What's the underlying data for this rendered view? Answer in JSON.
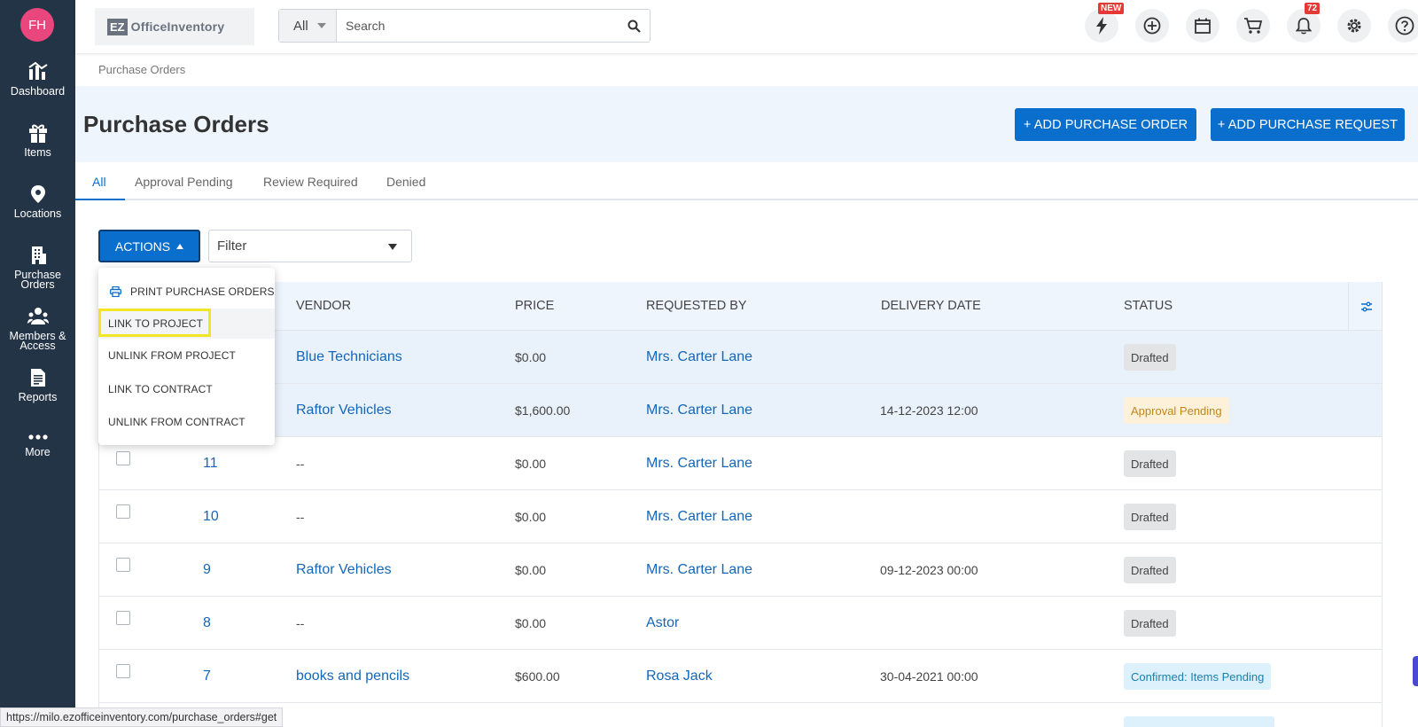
{
  "user": {
    "initials": "FH"
  },
  "sidebar": {
    "items": [
      {
        "id": "dashboard",
        "line1": "Dashboard",
        "line2": ""
      },
      {
        "id": "items",
        "line1": "Items",
        "line2": ""
      },
      {
        "id": "locations",
        "line1": "Locations",
        "line2": ""
      },
      {
        "id": "purchase-orders",
        "line1": "Purchase",
        "line2": "Orders"
      },
      {
        "id": "members",
        "line1": "Members &",
        "line2": "Access"
      },
      {
        "id": "reports",
        "line1": "Reports",
        "line2": ""
      },
      {
        "id": "more",
        "line1": "More",
        "line2": ""
      }
    ]
  },
  "logo": {
    "mark": "EZ",
    "text": "OfficeInventory"
  },
  "search": {
    "scope": "All",
    "placeholder": "Search"
  },
  "top_icons": {
    "new_badge": "NEW",
    "notification_count": "72"
  },
  "breadcrumb": "Purchase Orders",
  "page": {
    "title": "Purchase Orders",
    "add_order_label": "+ ADD PURCHASE ORDER",
    "add_request_label": "+ ADD PURCHASE REQUEST"
  },
  "tabs": [
    "All",
    "Approval Pending",
    "Review Required",
    "Denied"
  ],
  "toolbar": {
    "actions_label": "ACTIONS",
    "filter_label": "Filter"
  },
  "actions_menu": [
    "PRINT PURCHASE ORDERS",
    "LINK TO PROJECT",
    "UNLINK FROM PROJECT",
    "LINK TO CONTRACT",
    "UNLINK FROM CONTRACT"
  ],
  "table": {
    "columns": [
      "VENDOR",
      "PRICE",
      "REQUESTED BY",
      "DELIVERY DATE",
      "STATUS"
    ],
    "rows": [
      {
        "id": "",
        "vendor": "Blue Technicians",
        "price": "$0.00",
        "requested_by": "Mrs. Carter Lane",
        "delivery": "",
        "status": "Drafted"
      },
      {
        "id": "",
        "vendor": "Raftor Vehicles",
        "price": "$1,600.00",
        "requested_by": "Mrs. Carter Lane",
        "delivery": "14-12-2023 12:00",
        "status": "Approval Pending"
      },
      {
        "id": "11",
        "vendor": "--",
        "price": "$0.00",
        "requested_by": "Mrs. Carter Lane",
        "delivery": "",
        "status": "Drafted"
      },
      {
        "id": "10",
        "vendor": "--",
        "price": "$0.00",
        "requested_by": "Mrs. Carter Lane",
        "delivery": "",
        "status": "Drafted"
      },
      {
        "id": "9",
        "vendor": "Raftor Vehicles",
        "price": "$0.00",
        "requested_by": "Mrs. Carter Lane",
        "delivery": "09-12-2023 00:00",
        "status": "Drafted"
      },
      {
        "id": "8",
        "vendor": "--",
        "price": "$0.00",
        "requested_by": "Astor",
        "delivery": "",
        "status": "Drafted"
      },
      {
        "id": "7",
        "vendor": "books and pencils",
        "price": "$600.00",
        "requested_by": "Rosa Jack",
        "delivery": "30-04-2021 00:00",
        "status": "Confirmed: Items Pending"
      }
    ]
  },
  "status_bar_url": "https://milo.ezofficeinventory.com/purchase_orders#get"
}
